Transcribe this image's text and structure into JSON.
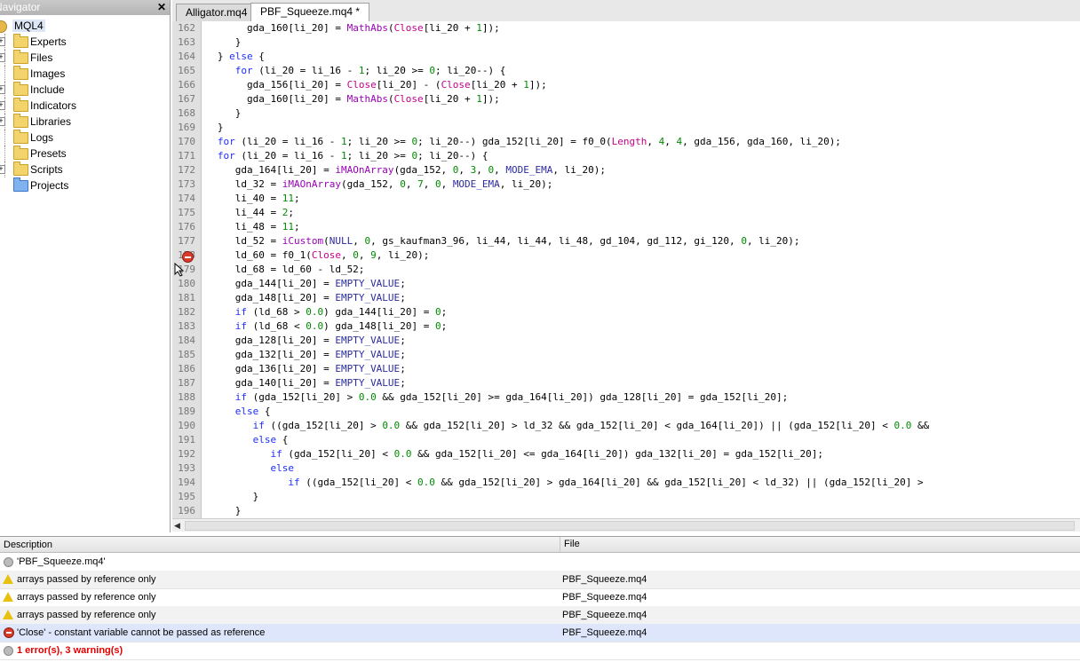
{
  "navigator": {
    "title": "Navigator",
    "root": "MQL4",
    "items": [
      "Experts",
      "Files",
      "Images",
      "Include",
      "Indicators",
      "Libraries",
      "Logs",
      "Presets",
      "Scripts",
      "Projects"
    ]
  },
  "tabs": [
    {
      "label": "Alligator.mq4",
      "active": false
    },
    {
      "label": "PBF_Squeeze.mq4 *",
      "active": true
    }
  ],
  "editor": {
    "line_numbers": [
      "162",
      "163",
      "164",
      "165",
      "166",
      "167",
      "168",
      "169",
      "170",
      "171",
      "172",
      "173",
      "174",
      "175",
      "176",
      "177",
      "178",
      "179",
      "180",
      "181",
      "182",
      "183",
      "184",
      "185",
      "186",
      "187",
      "188",
      "189",
      "190",
      "191",
      "192",
      "193",
      "194",
      "195",
      "196"
    ],
    "lines": [
      "        gda_160[li_20] = MathAbs(Close[li_20 + 1]);",
      "      }",
      "   } else {",
      "      for (li_20 = li_16 - 1; li_20 >= 0; li_20--) {",
      "        gda_156[li_20] = Close[li_20] - (Close[li_20 + 1]);",
      "        gda_160[li_20] = MathAbs(Close[li_20 + 1]);",
      "      }",
      "   }",
      "   for (li_20 = li_16 - 1; li_20 >= 0; li_20--) gda_152[li_20] = f0_0(Length, 4, 4, gda_156, gda_160, li_20);",
      "   for (li_20 = li_16 - 1; li_20 >= 0; li_20--) {",
      "      gda_164[li_20] = iMAOnArray(gda_152, 0, 3, 0, MODE_EMA, li_20);",
      "      ld_32 = iMAOnArray(gda_152, 0, 7, 0, MODE_EMA, li_20);",
      "      li_40 = 11;",
      "      li_44 = 2;",
      "      li_48 = 11;",
      "      ld_52 = iCustom(NULL, 0, gs_kaufman3_96, li_44, li_44, li_48, gd_104, gd_112, gi_120, 0, li_20);",
      "      ld_60 = f0_1(Close, 0, 9, li_20);",
      "      ld_68 = ld_60 - ld_52;",
      "      gda_144[li_20] = EMPTY_VALUE;",
      "      gda_148[li_20] = EMPTY_VALUE;",
      "      if (ld_68 > 0.0) gda_144[li_20] = 0;",
      "      if (ld_68 < 0.0) gda_148[li_20] = 0;",
      "      gda_128[li_20] = EMPTY_VALUE;",
      "      gda_132[li_20] = EMPTY_VALUE;",
      "      gda_136[li_20] = EMPTY_VALUE;",
      "      gda_140[li_20] = EMPTY_VALUE;",
      "      if (gda_152[li_20] > 0.0 && gda_152[li_20] >= gda_164[li_20]) gda_128[li_20] = gda_152[li_20];",
      "      else {",
      "         if ((gda_152[li_20] > 0.0 && gda_152[li_20] > ld_32 && gda_152[li_20] < gda_164[li_20]) || (gda_152[li_20] < 0.0 &&",
      "         else {",
      "            if (gda_152[li_20] < 0.0 && gda_152[li_20] <= gda_164[li_20]) gda_132[li_20] = gda_152[li_20];",
      "            else",
      "               if ((gda_152[li_20] < 0.0 && gda_152[li_20] > gda_164[li_20] && gda_152[li_20] < ld_32) || (gda_152[li_20] >",
      "         }",
      "      }"
    ]
  },
  "toolbox": {
    "col_description": "Description",
    "col_file": "File",
    "rows": [
      {
        "type": "info",
        "description": "'PBF_Squeeze.mq4'",
        "file": ""
      },
      {
        "type": "warning",
        "description": "arrays passed by reference only",
        "file": "PBF_Squeeze.mq4"
      },
      {
        "type": "warning",
        "description": "arrays passed by reference only",
        "file": "PBF_Squeeze.mq4"
      },
      {
        "type": "warning",
        "description": "arrays passed by reference only",
        "file": "PBF_Squeeze.mq4"
      },
      {
        "type": "error",
        "description": "'Close' - constant variable cannot be passed as reference",
        "file": "PBF_Squeeze.mq4"
      }
    ],
    "summary": "1 error(s), 3 warning(s)"
  },
  "colors": {
    "keyword": "#1d2dff",
    "function": "#9a00b8",
    "predefined": "#c0008c",
    "number": "#008a00",
    "constant": "#2b2b9e",
    "error": "#e60000",
    "selected_row": "#dde6fa"
  },
  "icons": {
    "error_marker": "error-circle-icon",
    "warning": "warning-triangle-icon",
    "folder": "folder-icon"
  }
}
